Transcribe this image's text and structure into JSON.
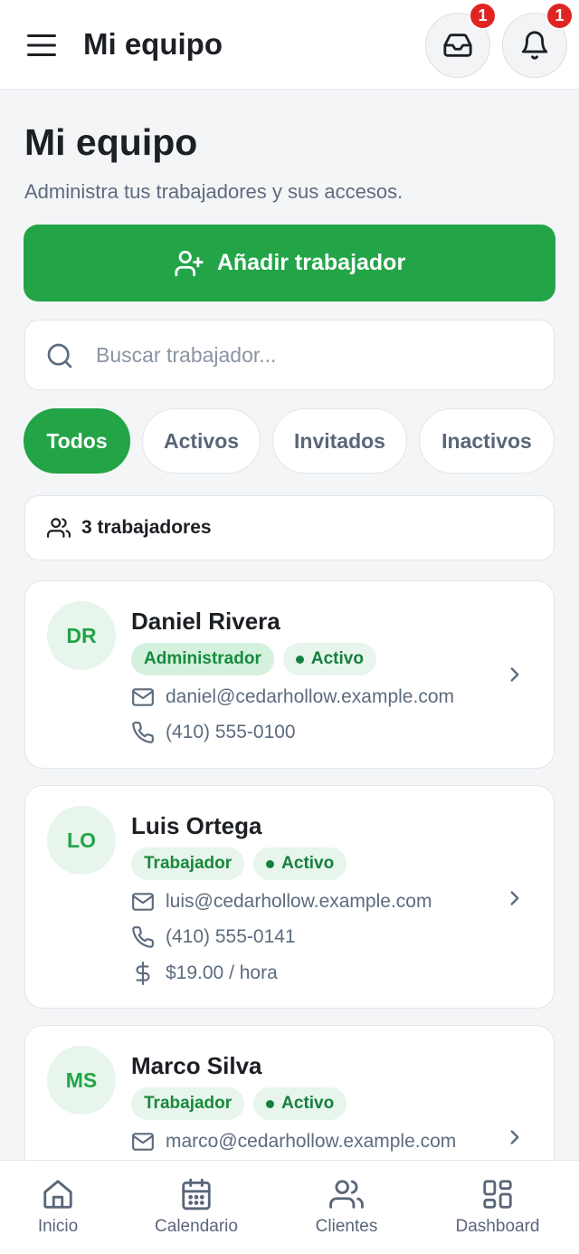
{
  "topbar": {
    "title": "Mi equipo",
    "inbox_badge": "1",
    "bell_badge": "1"
  },
  "header": {
    "title": "Mi equipo",
    "subtitle": "Administra tus trabajadores y sus accesos."
  },
  "add_button": {
    "label": "Añadir trabajador"
  },
  "search": {
    "placeholder": "Buscar trabajador...",
    "value": ""
  },
  "filters": [
    {
      "label": "Todos",
      "active": true
    },
    {
      "label": "Activos",
      "active": false
    },
    {
      "label": "Invitados",
      "active": false
    },
    {
      "label": "Inactivos",
      "active": false
    }
  ],
  "count": {
    "label": "3 trabajadores"
  },
  "workers": [
    {
      "initials": "DR",
      "name": "Daniel Rivera",
      "role": "Administrador",
      "status": "Activo",
      "email": "daniel@cedarhollow.example.com",
      "phone": "(410) 555-0100"
    },
    {
      "initials": "LO",
      "name": "Luis Ortega",
      "role": "Trabajador",
      "status": "Activo",
      "email": "luis@cedarhollow.example.com",
      "phone": "(410) 555-0141",
      "rate": "$19.00 / hora"
    },
    {
      "initials": "MS",
      "name": "Marco Silva",
      "role": "Trabajador",
      "status": "Activo",
      "email": "marco@cedarhollow.example.com"
    }
  ],
  "bottom_nav": [
    {
      "label": "Inicio",
      "icon": "home-icon"
    },
    {
      "label": "Calendario",
      "icon": "calendar-icon"
    },
    {
      "label": "Clientes",
      "icon": "users-icon"
    },
    {
      "label": "Dashboard",
      "icon": "dashboard-icon"
    }
  ],
  "colors": {
    "accent": "#22a447",
    "badge": "#e02424",
    "background": "#f4f5f6"
  }
}
